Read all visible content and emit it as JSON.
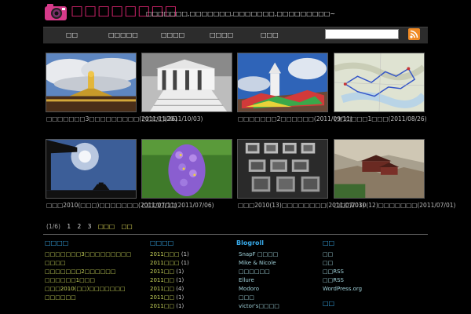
{
  "header": {
    "site_title": "□□□□□□□□",
    "tagline": "□□□□□□□,□□□□□□□,□□□□□□□,□□□□□□□□□~"
  },
  "nav": {
    "items": [
      "□□",
      "□□□□□",
      "□□□□",
      "□□□□",
      "□□□"
    ]
  },
  "search": {
    "value": ""
  },
  "posts": [
    {
      "caption": "□□□□□□□3□□□□□□□□□(2011/11/26)"
    },
    {
      "caption": "□□□□(2011/10/03)"
    },
    {
      "caption": "□□□□□□□2□□□□□□(2011/09/11)"
    },
    {
      "caption": "□□□□□□1□□□(2011/08/26)"
    },
    {
      "caption": "□□□2010(□□□)□□□□□□□(2011/07/11)"
    },
    {
      "caption": "□□□□□□(2011/07/06)"
    },
    {
      "caption": "□□□2010(13)□□□□□□□□(2011/07/03)"
    },
    {
      "caption": "□□□2010(12)□□□□□□□(2011/07/01)"
    }
  ],
  "pager": {
    "info": "(1/6)",
    "pages": [
      "1",
      "2",
      "3"
    ],
    "next": "□□□",
    "last": "□□"
  },
  "sidebar": {
    "recent": {
      "heading": "□□□□",
      "items": [
        "□□□□□□□3□□□□□□□□□",
        "□□□□",
        "□□□□□□□2□□□□□□",
        "□□□□□□1□□□",
        "□□□2010(□□)□□□□□□□",
        "□□□□□□"
      ]
    },
    "archives": {
      "heading": "□□□□",
      "items": [
        {
          "label": "2011□□□",
          "count": "(1)"
        },
        {
          "label": "2011□□□",
          "count": "(1)"
        },
        {
          "label": "2011□□",
          "count": "(1)"
        },
        {
          "label": "2011□□",
          "count": "(1)"
        },
        {
          "label": "2011□□",
          "count": "(4)"
        },
        {
          "label": "2011□□",
          "count": "(1)"
        },
        {
          "label": "2011□□",
          "count": "(1)"
        }
      ]
    },
    "blogroll": {
      "heading": "Blogroll",
      "items": [
        "SnapF □□□□",
        "Mike & Nicole",
        "□□□□□□",
        "Ellure",
        "Modoro",
        "□□□",
        "victor's□□□□"
      ]
    },
    "meta": {
      "heading": "□□",
      "items": [
        "□□",
        "□□",
        "□□RSS",
        "□□RSS",
        "WordPress.org"
      ],
      "heading2": "□□"
    }
  },
  "colors": {
    "title": "#d6246e",
    "heading": "#38a9e8",
    "link": "#c8d45a",
    "nav_bg": "#2c2c2c"
  },
  "icons": {
    "logo": "camera-icon",
    "feed": "rss-icon"
  }
}
